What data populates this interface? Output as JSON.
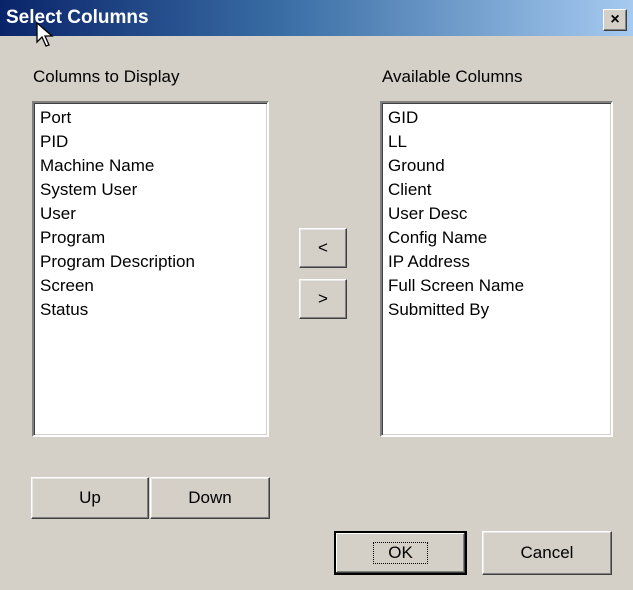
{
  "window": {
    "title": "Select Columns",
    "close_label": "×"
  },
  "columns_to_display": {
    "label": "Columns to Display",
    "items": [
      "Port",
      "PID",
      "Machine Name",
      "System User",
      "User",
      "Program",
      "Program Description",
      "Screen",
      "Status"
    ]
  },
  "available_columns": {
    "label": "Available Columns",
    "items": [
      "GID",
      "LL",
      "Ground",
      "Client",
      "User Desc",
      "Config Name",
      "IP Address",
      "Full Screen Name",
      "Submitted By"
    ]
  },
  "move_buttons": {
    "add_label": "<",
    "remove_label": ">"
  },
  "order_buttons": {
    "up_label": "Up",
    "down_label": "Down"
  },
  "dialog_buttons": {
    "ok_label": "OK",
    "cancel_label": "Cancel"
  }
}
